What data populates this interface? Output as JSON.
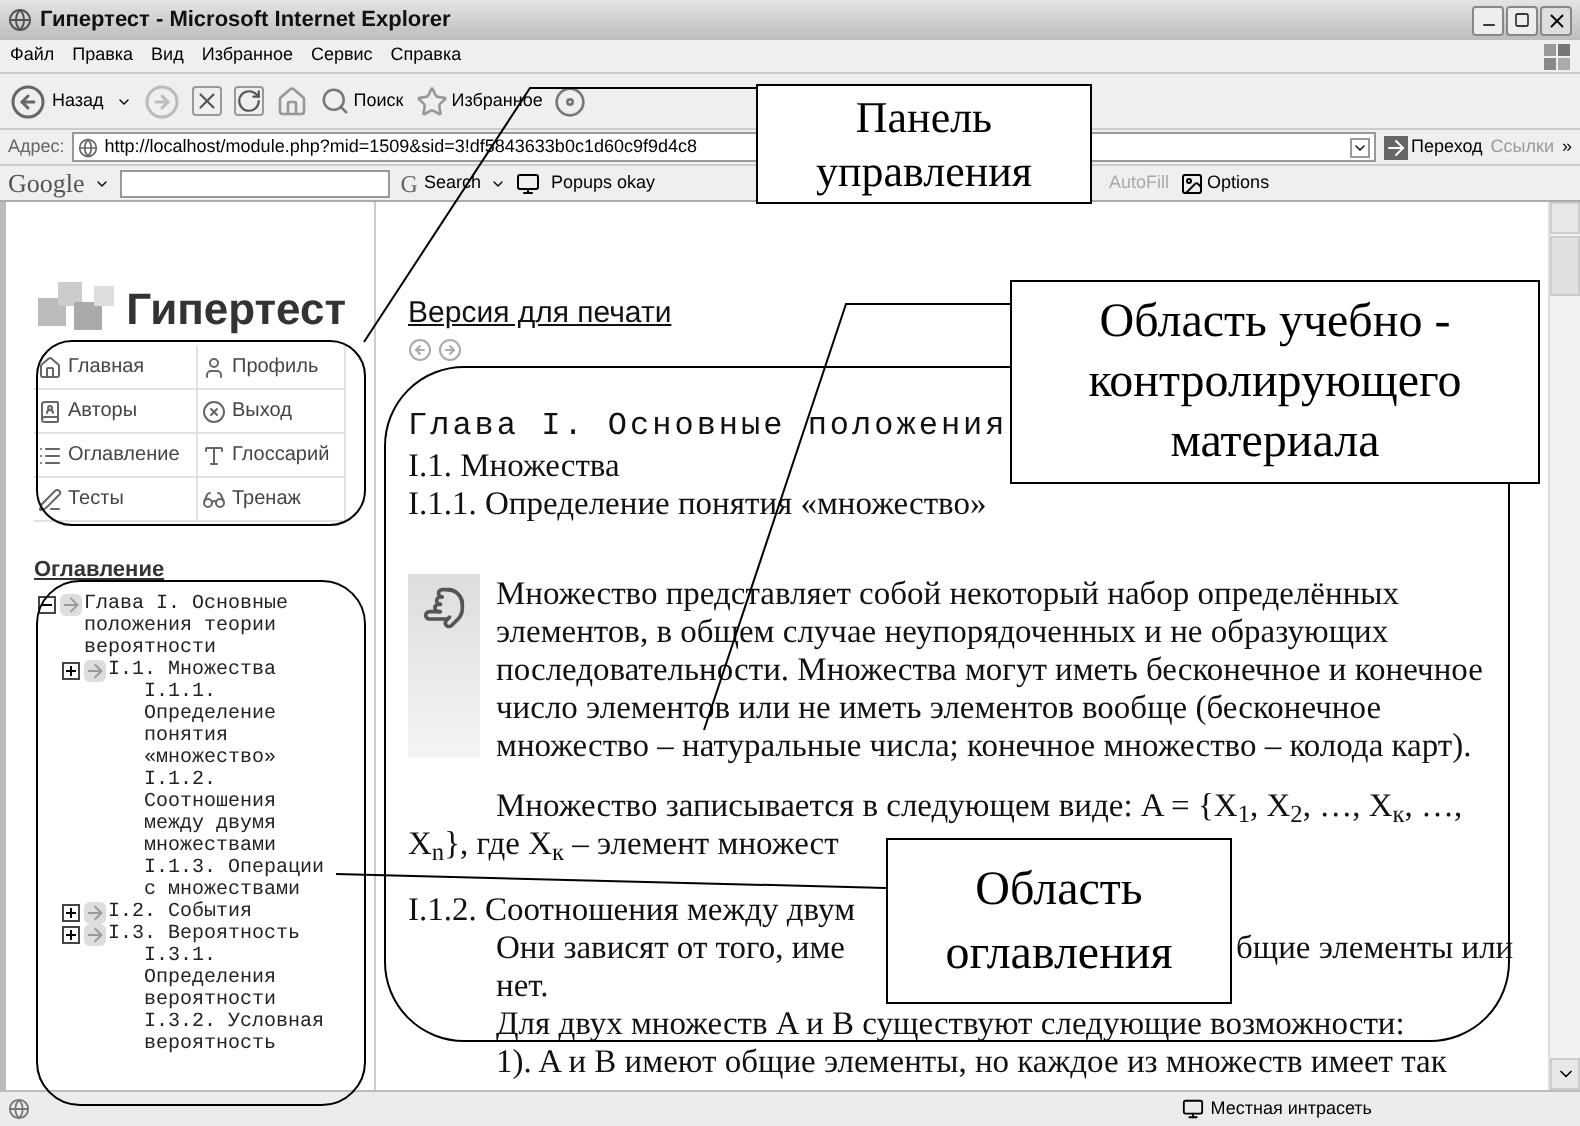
{
  "window": {
    "title": "Гипертест - Microsoft Internet Explorer"
  },
  "menu": [
    "Файл",
    "Правка",
    "Вид",
    "Избранное",
    "Сервис",
    "Справка"
  ],
  "toolbar": {
    "back": "Назад",
    "search": "Поиск",
    "favorites": "Избранное"
  },
  "address_bar": {
    "label": "Адрес:",
    "value": "http://localhost/module.php?mid=1509&sid=3!df5843633b0c1d60c9f9d4c8",
    "go": "Переход",
    "links": "Ссылки",
    "more": "»"
  },
  "google_bar": {
    "logo": "Google",
    "search_letter": "G",
    "search": "Search",
    "popups": "Popups okay",
    "autofill": "AutoFill",
    "options": "Options"
  },
  "sidebar": {
    "logo": "Гипертест",
    "nav": [
      "Главная",
      "Профиль",
      "Авторы",
      "Выход",
      "Оглавление",
      "Глоссарий",
      "Тесты",
      "Тренаж"
    ],
    "toc_title": "Оглавление",
    "toc": [
      {
        "label": "Глава I. Основные положения теории вероятности",
        "expanded": true,
        "children": [
          {
            "label": "I.1. Множества",
            "expanded": false,
            "children": [
              {
                "label": "I.1.1. Определение понятия «множество»"
              },
              {
                "label": "I.1.2. Соотношения между двумя множествами"
              },
              {
                "label": "I.1.3. Операции с множествами"
              }
            ]
          },
          {
            "label": "I.2. События",
            "expanded": false
          },
          {
            "label": "I.3. Вероятность",
            "expanded": false,
            "children": [
              {
                "label": "I.3.1. Определения вероятности"
              },
              {
                "label": "I.3.2. Условная вероятность"
              }
            ]
          }
        ]
      }
    ]
  },
  "content": {
    "print_link": "Версия для печати",
    "chapter": "Глава I. Основные положения",
    "section": "I.1. Множества",
    "subsection": "I.1.1. Определение понятия «множество»",
    "definition": "Множество представляет собой некоторый набор определённых элементов, в общем случае неупорядоченных и не образующих последовательности. Множества могут иметь бесконечное и конечное число элементов или не иметь элементов вообще (бесконечное множество – натуральные числа; конечное множество – колода карт).",
    "notation": "Множество записывается в следующем виде: A = {X$_{1}$, X$_{2}$, …, X$_{к}$, …, X$_{n}$}, где X$_{к}$ – элемент множест",
    "subsection_2": "I.1.2. Соотношения между двум",
    "line_a": "Они зависят от того, име",
    "line_b": "бщие элементы или",
    "line_c": "нет.",
    "line_d": "Для двух множеств A и B существуют следующие возможности:",
    "line_e": "1). A и B имеют общие элементы, но каждое из множеств имеет так"
  },
  "callouts": [
    {
      "text": "Панель управления"
    },
    {
      "text": "Область учебно - контролирующего материала"
    },
    {
      "text": "Область оглавления"
    }
  ],
  "status_bar": {
    "zone": "Местная интрасеть"
  }
}
